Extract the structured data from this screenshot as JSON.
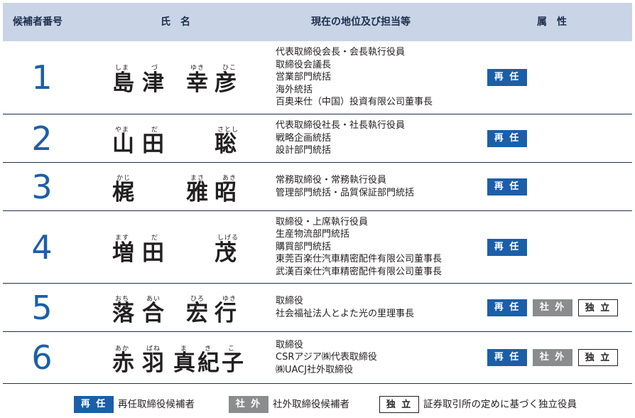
{
  "header": {
    "number": "候補者番号",
    "name": "氏　名",
    "position": "現在の地位及び担当等",
    "attributes": "属　性"
  },
  "candidates": [
    {
      "number": "1",
      "ruby": [
        "しま",
        "づ",
        "ゆき",
        "ひこ"
      ],
      "kanji": [
        "島",
        "津",
        "幸",
        "彦"
      ],
      "positions": [
        "代表取締役会長・会長執行役員",
        "取締役会議長",
        "営業部門統括",
        "海外統括",
        "百奥来仕（中国）投資有限公司董事長"
      ],
      "attributes": [
        "再 任"
      ]
    },
    {
      "number": "2",
      "ruby": [
        "やま",
        "だ",
        "さとし"
      ],
      "kanji": [
        "山",
        "田",
        "聡"
      ],
      "positions": [
        "代表取締役社長・社長執行役員",
        "戦略企画統括",
        "設計部門統括"
      ],
      "attributes": [
        "再 任"
      ]
    },
    {
      "number": "3",
      "ruby": [
        "かじ",
        "まさ",
        "あき"
      ],
      "kanji": [
        "梶",
        "雅",
        "昭"
      ],
      "positions": [
        "常務取締役・常務執行役員",
        "管理部門統括・品質保証部門統括"
      ],
      "attributes": [
        "再 任"
      ]
    },
    {
      "number": "4",
      "ruby": [
        "ます",
        "だ",
        "しげる"
      ],
      "kanji": [
        "増",
        "田",
        "茂"
      ],
      "positions": [
        "取締役・上席執行役員",
        "生産物流部門統括",
        "購買部門統括",
        "東莞百楽仕汽車精密配件有限公司董事長",
        "武漢百楽仕汽車精密配件有限公司董事長"
      ],
      "attributes": [
        "再 任"
      ]
    },
    {
      "number": "5",
      "ruby": [
        "おち",
        "あい",
        "ひろ",
        "ゆき"
      ],
      "kanji": [
        "落",
        "合",
        "宏",
        "行"
      ],
      "positions": [
        "取締役",
        "社会福祉法人とよた光の里理事長"
      ],
      "attributes": [
        "再 任",
        "社 外",
        "独 立"
      ]
    },
    {
      "number": "6",
      "ruby": [
        "あか",
        "ばね",
        "ま",
        "き",
        "こ"
      ],
      "kanji": [
        "赤",
        "羽",
        "真",
        "紀",
        "子"
      ],
      "positions": [
        "取締役",
        "CSRアジア㈱代表取締役",
        "㈱UACJ社外取締役"
      ],
      "attributes": [
        "再 任",
        "社 外",
        "独 立"
      ]
    }
  ],
  "legend": {
    "saininn_badge": "再 任",
    "saininn_text": "再任取締役候補者",
    "shagai_badge": "社 外",
    "shagai_text": "社外取締役候補者",
    "dokuritsu_badge": "独 立",
    "dokuritsu_text": "証券取引所の定めに基づく独立役員"
  },
  "colors": {
    "header_bg": "#c9d5e6",
    "number_blue": "#1b5fa8",
    "badge_reappoint": "#1b5fa8",
    "badge_outside": "#8a8c8e"
  }
}
